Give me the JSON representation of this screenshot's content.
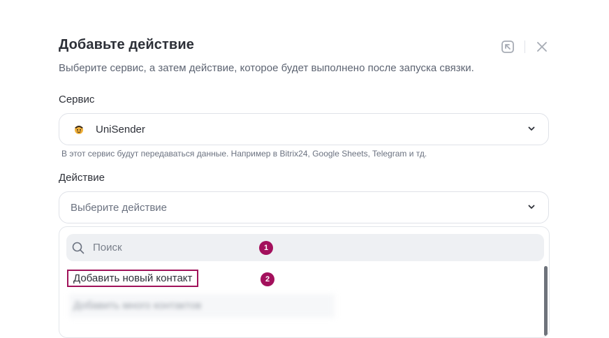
{
  "dialog": {
    "title": "Добавьте действие",
    "subtitle": "Выберите сервис, а затем действие, которое будет выполнено после запуска связки."
  },
  "service": {
    "label": "Сервис",
    "value": "UniSender",
    "hint": "В этот сервис будут передаваться данные. Например в Bitrix24, Google Sheets, Telegram и тд."
  },
  "action": {
    "label": "Действие",
    "placeholder": "Выберите действие"
  },
  "dropdown": {
    "search_placeholder": "Поиск",
    "options": [
      "Добавить новый контакт",
      "Добавить много контактов"
    ]
  },
  "annotations": [
    "1",
    "2"
  ],
  "colors": {
    "accent": "#a3105c",
    "border": "#dfe2e8",
    "search_bg": "#eef0f3"
  },
  "icons": [
    "unisender-logo-icon",
    "chevron-down-icon",
    "search-icon",
    "collapse-icon",
    "close-icon"
  ]
}
